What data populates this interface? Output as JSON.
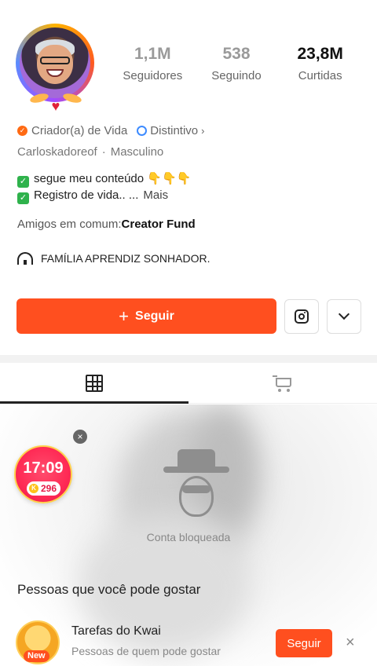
{
  "profile": {
    "stats": [
      {
        "value": "1,1M",
        "label": "Seguidores"
      },
      {
        "value": "538",
        "label": "Seguindo"
      },
      {
        "value": "23,8M",
        "label": "Curtidas"
      }
    ],
    "tags": {
      "creator": "Criador(a) de Vida",
      "badge": "Distintivo",
      "badge_chevron": "›"
    },
    "meta": {
      "username": "Carloskadoreof",
      "separator": "·",
      "gender": "Masculino"
    },
    "bio": {
      "line1": "segue meu conteúdo 👇👇👇",
      "line2": "Registro de vida.. ...",
      "more": "Mais"
    },
    "friends": {
      "label": "Amigos em comum:",
      "name": "Creator Fund"
    },
    "family": "FAMÍLIA APRENDIZ SONHADOR."
  },
  "actions": {
    "follow_plus": "+",
    "follow_label": "Seguir"
  },
  "tabs": [
    {
      "icon": "grid-icon",
      "active": true
    },
    {
      "icon": "cart-icon",
      "active": false
    }
  ],
  "content": {
    "blocked_label": "Conta bloqueada"
  },
  "timer": {
    "time": "17:09",
    "coins": "296",
    "coin_symbol": "K",
    "close_symbol": "×"
  },
  "suggestions": {
    "title": "Pessoas que você pode gostar",
    "items": [
      {
        "name": "Tarefas do Kwai",
        "subtitle": "Pessoas de quem pode gostar",
        "badge": "New",
        "follow_label": "Seguir",
        "dismiss_symbol": "×"
      }
    ]
  },
  "colors": {
    "accent": "#ff4f1f",
    "timer_red": "#ff2a55",
    "check_green": "#2fb24c",
    "badge_blue": "#3d8bff"
  }
}
